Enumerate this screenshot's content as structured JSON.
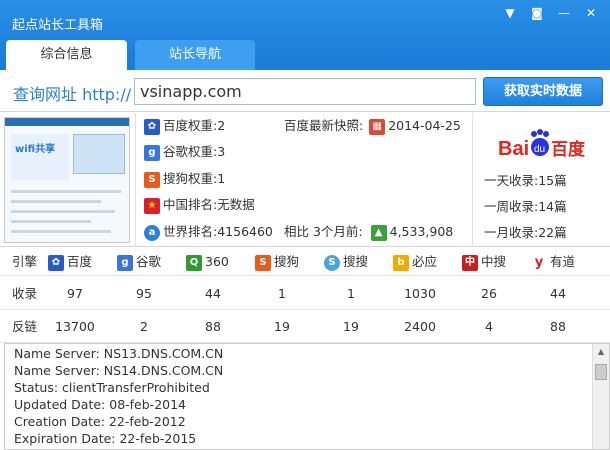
{
  "app": {
    "title": "起点站长工具箱"
  },
  "window_buttons": {
    "pin": "▼",
    "menu": "◙",
    "minimize": "—",
    "close": "✕"
  },
  "tabs": [
    {
      "label": "综合信息"
    },
    {
      "label": "站长导航"
    }
  ],
  "query": {
    "label": "查询网址 http://",
    "value": "vsinapp.com",
    "button": "获取实时数据"
  },
  "metrics": {
    "baidu_weight": "百度权重:2",
    "baidu_snapshot_label": "百度最新快照:",
    "baidu_snapshot_date": "2014-04-25",
    "google_weight": "谷歌权重:3",
    "sogou_weight": "搜狗权重:1",
    "china_rank": "中国排名:无数据",
    "world_rank": "世界排名:4156460",
    "compare_label": "相比 3个月前:",
    "compare_value": "4,533,908"
  },
  "baidu_logo": {
    "text_bai": "Bai",
    "text_du": "du",
    "text_cn": "百度"
  },
  "baidu_index": [
    "一天收录:15篇",
    "一周收录:14篇",
    "一月收录:22篇"
  ],
  "engines": {
    "header": "引擎",
    "list": [
      "百度",
      "谷歌",
      "360",
      "搜狗",
      "搜搜",
      "必应",
      "中搜",
      "有道"
    ],
    "icons": [
      "baidu-paw",
      "g",
      "q",
      "s",
      "soso",
      "bing",
      "z",
      "y"
    ],
    "colors": [
      "#2a5cc7",
      "#3a76d9",
      "#2f9b2f",
      "#e85b1f",
      "#4aa3df",
      "#f2a900",
      "#c9211e",
      "#d8202a"
    ]
  },
  "rows": [
    {
      "label": "收录",
      "values": [
        "97",
        "95",
        "44",
        "1",
        "1",
        "1030",
        "26",
        "44"
      ]
    },
    {
      "label": "反链",
      "values": [
        "13700",
        "2",
        "88",
        "19",
        "19",
        "2400",
        "4",
        "88"
      ]
    }
  ],
  "whois": [
    "Name Server: NS13.DNS.COM.CN",
    "Name Server: NS14.DNS.COM.CN",
    "Status: clientTransferProhibited",
    "Updated Date: 08-feb-2014",
    "Creation Date: 22-feb-2012",
    "Expiration Date: 22-feb-2015"
  ]
}
